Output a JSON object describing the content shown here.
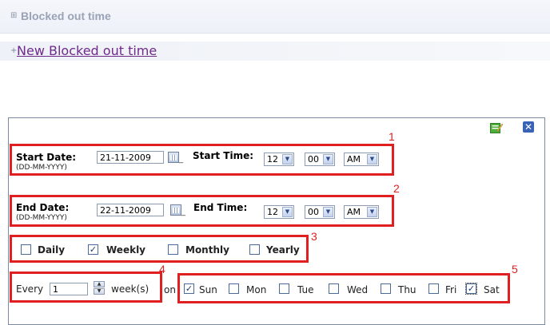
{
  "header": {
    "title": "Blocked out time",
    "collapse_glyph": "⊞"
  },
  "new_link": {
    "glyph": "+",
    "label": "New Blocked out time"
  },
  "dialog": {
    "icons": [
      "save-edit-icon",
      "close-icon"
    ],
    "callouts": [
      "1",
      "2",
      "3",
      "4",
      "5"
    ],
    "start": {
      "date_label": "Start Date:",
      "date_hint": "(DD-MM-YYYY)",
      "date_value": "21-11-2009",
      "time_label": "Start Time:",
      "hour": "12",
      "minute": "00",
      "ampm": "AM"
    },
    "end": {
      "date_label": "End Date:",
      "date_hint": "(DD-MM-YYYY)",
      "date_value": "22-11-2009",
      "time_label": "End Time:",
      "hour": "12",
      "minute": "00",
      "ampm": "AM"
    },
    "frequency": [
      {
        "label": "Daily",
        "checked": false
      },
      {
        "label": "Weekly",
        "checked": true
      },
      {
        "label": "Monthly",
        "checked": false
      },
      {
        "label": "Yearly",
        "checked": false
      }
    ],
    "every": {
      "label": "Every",
      "value": "1",
      "unit": "week(s)",
      "on": "on"
    },
    "days": [
      {
        "label": "Sun",
        "checked": true
      },
      {
        "label": "Mon",
        "checked": false
      },
      {
        "label": "Tue",
        "checked": false
      },
      {
        "label": "Wed",
        "checked": false
      },
      {
        "label": "Thu",
        "checked": false
      },
      {
        "label": "Fri",
        "checked": false
      },
      {
        "label": "Sat",
        "checked": true
      }
    ],
    "colors": {
      "callout_red": "#e02020",
      "link_purple": "#6f2a8c",
      "accent_blue": "#3a63b8"
    }
  }
}
